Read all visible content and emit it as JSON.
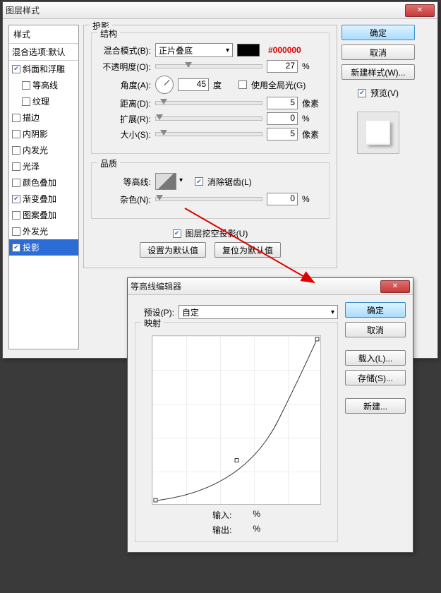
{
  "dialog1": {
    "title": "图层样式",
    "close": "✕",
    "styles_header": "样式",
    "blend_opts": "混合选项:默认",
    "items": [
      {
        "label": "斜面和浮雕",
        "checked": true
      },
      {
        "label": "等高线",
        "checked": false,
        "indent": true
      },
      {
        "label": "纹理",
        "checked": false,
        "indent": true
      },
      {
        "label": "描边",
        "checked": false
      },
      {
        "label": "内阴影",
        "checked": false
      },
      {
        "label": "内发光",
        "checked": false
      },
      {
        "label": "光泽",
        "checked": false
      },
      {
        "label": "颜色叠加",
        "checked": false
      },
      {
        "label": "渐变叠加",
        "checked": true
      },
      {
        "label": "图案叠加",
        "checked": false
      },
      {
        "label": "外发光",
        "checked": false
      },
      {
        "label": "投影",
        "checked": true,
        "selected": true
      }
    ],
    "panel_title": "投影",
    "structure_title": "结构",
    "blend_label": "混合模式(B):",
    "blend_value": "正片叠底",
    "hex": "#000000",
    "opacity_label": "不透明度(O):",
    "opacity_value": "27",
    "pct": "%",
    "angle_label": "角度(A):",
    "angle_value": "45",
    "angle_unit": "度",
    "global_light": "使用全局光(G)",
    "distance_label": "距离(D):",
    "distance_value": "5",
    "px": "像素",
    "spread_label": "扩展(R):",
    "spread_value": "0",
    "size_label": "大小(S):",
    "size_value": "5",
    "quality_title": "品质",
    "contour_label": "等高线:",
    "antialias": "消除锯齿(L)",
    "noise_label": "杂色(N):",
    "noise_value": "0",
    "knockout": "图层挖空投影(U)",
    "reset_default": "设置为默认值",
    "reset_to_default": "复位为默认值",
    "buttons": {
      "ok": "确定",
      "cancel": "取消",
      "newstyle": "新建样式(W)...",
      "preview": "预览(V)"
    }
  },
  "dialog2": {
    "title": "等高线编辑器",
    "close": "✕",
    "preset_label": "预设(P):",
    "preset_value": "自定",
    "mapping_title": "映射",
    "input_label": "输入:",
    "output_label": "输出:",
    "pct": "%",
    "buttons": {
      "ok": "确定",
      "cancel": "取消",
      "load": "载入(L)...",
      "save": "存储(S)...",
      "new": "新建..."
    }
  }
}
